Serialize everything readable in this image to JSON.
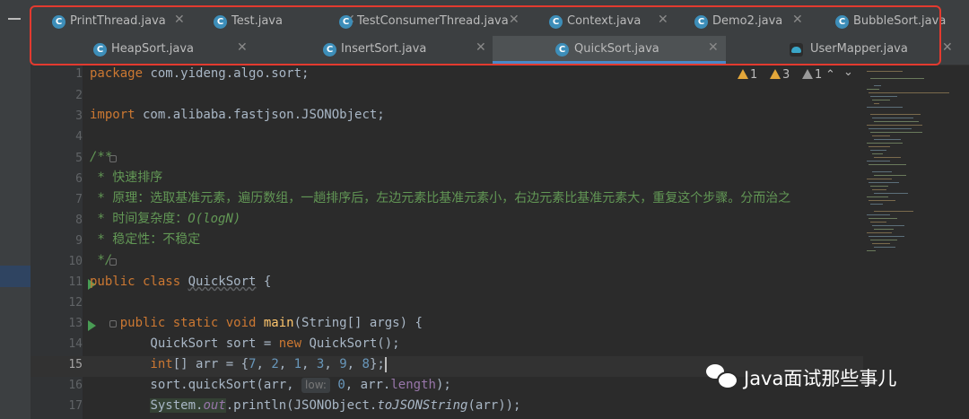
{
  "tabs_row1": [
    {
      "label": "PrintThread.java",
      "icon": "c"
    },
    {
      "label": "Test.java",
      "icon": "c"
    },
    {
      "label": "TestConsumerThread.java",
      "icon": "c"
    },
    {
      "label": "Context.java",
      "icon": "c"
    },
    {
      "label": "Demo2.java",
      "icon": "c"
    },
    {
      "label": "BubbleSort.java",
      "icon": "c"
    }
  ],
  "tabs_row2": [
    {
      "label": "HeapSort.java",
      "icon": "c"
    },
    {
      "label": "InsertSort.java",
      "icon": "c"
    },
    {
      "label": "QuickSort.java",
      "icon": "c",
      "active": true
    },
    {
      "label": "UserMapper.java",
      "icon": "mybatis"
    }
  ],
  "tab_close": "✕",
  "problems": {
    "warnings": "1",
    "weak_warnings": "3",
    "typos": "1"
  },
  "icon_letter": "C",
  "lines": {
    "n1": "1",
    "n2": "2",
    "n3": "3",
    "n4": "4",
    "n5": "5",
    "n6": "6",
    "n7": "7",
    "n8": "8",
    "n9": "9",
    "n10": "10",
    "n11": "11",
    "n12": "12",
    "n13": "13",
    "n14": "14",
    "n15": "15",
    "n16": "16",
    "n17": "17"
  },
  "code": {
    "l1_kw": "package",
    "l1_rest": " com.yideng.algo.sort;",
    "l3_kw": "import",
    "l3_rest": " com.alibaba.fastjson.JSONObject;",
    "l5": "/**",
    "l6": " * 快速排序",
    "l7": " * 原理：选取基准元素，遍历数组，一趟排序后，左边元素比基准元素小，右边元素比基准元素大，重复这个步骤。分而治之",
    "l8_a": " * 时间复杂度：",
    "l8_b": "O(logN)",
    "l9": " * 稳定性：不稳定",
    "l10": " */",
    "l11_kw": "public class ",
    "l11_name": "QuickSort",
    "l11_rest": " {",
    "l13_kw": "    public static void ",
    "l13_fn": "main",
    "l13_rest": "(String[] args) {",
    "l14_a": "        QuickSort sort = ",
    "l14_kw": "new",
    "l14_b": " QuickSort();",
    "l15_kw": "        int",
    "l15_a": "[] arr = {",
    "l15_n1": "7",
    "l15_c1": ", ",
    "l15_n2": "2",
    "l15_c2": ", ",
    "l15_n3": "1",
    "l15_c3": ", ",
    "l15_n4": "3",
    "l15_c4": ", ",
    "l15_n5": "9",
    "l15_c5": ", ",
    "l15_n6": "8",
    "l15_b": "};",
    "l16_a": "        sort.quickSort(arr, ",
    "l16_hint": "low:",
    "l16_n": "0",
    "l16_b": ", arr.",
    "l16_fld": "length",
    "l16_c": ");",
    "l17_sys": "System",
    "l17_dot": ".",
    "l17_out": "out",
    "l17_a": ".println(JSONObject.",
    "l17_m": "toJSONString",
    "l17_b": "(arr));"
  },
  "watermark": "Java面试那些事儿",
  "colors": {
    "annotation": "#e33a2f",
    "active_underline": "#4a88c7",
    "keyword": "#cc7832",
    "comment": "#629755"
  }
}
